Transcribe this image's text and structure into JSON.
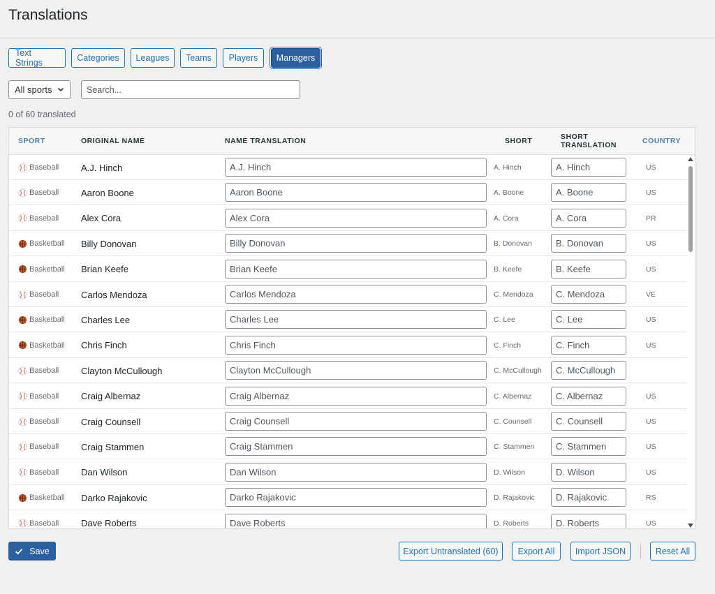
{
  "page": {
    "title": "Translations"
  },
  "tabs": [
    {
      "label": "Text Strings",
      "active": false
    },
    {
      "label": "Categories",
      "active": false
    },
    {
      "label": "Leagues",
      "active": false
    },
    {
      "label": "Teams",
      "active": false
    },
    {
      "label": "Players",
      "active": false
    },
    {
      "label": "Managers",
      "active": true
    }
  ],
  "filters": {
    "sport_select": {
      "selected": "All sports"
    },
    "search": {
      "placeholder": "Search...",
      "value": ""
    }
  },
  "progress": {
    "text": "0 of 60 translated"
  },
  "table": {
    "headers": {
      "sport": "SPORT",
      "original_name": "ORIGINAL NAME",
      "name_translation": "NAME TRANSLATION",
      "short": "SHORT",
      "short_translation_line1": "SHORT",
      "short_translation_line2": "TRANSLATION",
      "country": "COUNTRY"
    },
    "rows": [
      {
        "sport": "Baseball",
        "sport_icon": "baseball-icon",
        "original": "A.J. Hinch",
        "name_translation": "A.J. Hinch",
        "short": "A. Hinch",
        "short_translation": "A. Hinch",
        "country": "US"
      },
      {
        "sport": "Baseball",
        "sport_icon": "baseball-icon",
        "original": "Aaron Boone",
        "name_translation": "Aaron Boone",
        "short": "A. Boone",
        "short_translation": "A. Boone",
        "country": "US"
      },
      {
        "sport": "Baseball",
        "sport_icon": "baseball-icon",
        "original": "Alex Cora",
        "name_translation": "Alex Cora",
        "short": "A. Cora",
        "short_translation": "A. Cora",
        "country": "PR"
      },
      {
        "sport": "Basketball",
        "sport_icon": "basketball-icon",
        "original": "Billy Donovan",
        "name_translation": "Billy Donovan",
        "short": "B. Donovan",
        "short_translation": "B. Donovan",
        "country": "US"
      },
      {
        "sport": "Basketball",
        "sport_icon": "basketball-icon",
        "original": "Brian Keefe",
        "name_translation": "Brian Keefe",
        "short": "B. Keefe",
        "short_translation": "B. Keefe",
        "country": "US"
      },
      {
        "sport": "Baseball",
        "sport_icon": "baseball-icon",
        "original": "Carlos Mendoza",
        "name_translation": "Carlos Mendoza",
        "short": "C. Mendoza",
        "short_translation": "C. Mendoza",
        "country": "VE"
      },
      {
        "sport": "Basketball",
        "sport_icon": "basketball-icon",
        "original": "Charles Lee",
        "name_translation": "Charles Lee",
        "short": "C. Lee",
        "short_translation": "C. Lee",
        "country": "US"
      },
      {
        "sport": "Basketball",
        "sport_icon": "basketball-icon",
        "original": "Chris Finch",
        "name_translation": "Chris Finch",
        "short": "C. Finch",
        "short_translation": "C. Finch",
        "country": "US"
      },
      {
        "sport": "Baseball",
        "sport_icon": "baseball-icon",
        "original": "Clayton McCullough",
        "name_translation": "Clayton McCullough",
        "short": "C. McCullough",
        "short_translation": "C. McCullough",
        "country": ""
      },
      {
        "sport": "Baseball",
        "sport_icon": "baseball-icon",
        "original": "Craig Albernaz",
        "name_translation": "Craig Albernaz",
        "short": "C. Albernaz",
        "short_translation": "C. Albernaz",
        "country": "US"
      },
      {
        "sport": "Baseball",
        "sport_icon": "baseball-icon",
        "original": "Craig Counsell",
        "name_translation": "Craig Counsell",
        "short": "C. Counsell",
        "short_translation": "C. Counsell",
        "country": "US"
      },
      {
        "sport": "Baseball",
        "sport_icon": "baseball-icon",
        "original": "Craig Stammen",
        "name_translation": "Craig Stammen",
        "short": "C. Stammen",
        "short_translation": "C. Stammen",
        "country": "US"
      },
      {
        "sport": "Baseball",
        "sport_icon": "baseball-icon",
        "original": "Dan Wilson",
        "name_translation": "Dan Wilson",
        "short": "D. Wilson",
        "short_translation": "D. Wilson",
        "country": "US"
      },
      {
        "sport": "Basketball",
        "sport_icon": "basketball-icon",
        "original": "Darko Rajakovic",
        "name_translation": "Darko Rajakovic",
        "short": "D. Rajakovic",
        "short_translation": "D. Rajakovic",
        "country": "RS"
      },
      {
        "sport": "Baseball",
        "sport_icon": "baseball-icon",
        "original": "Dave Roberts",
        "name_translation": "Dave Roberts",
        "short": "D. Roberts",
        "short_translation": "D. Roberts",
        "country": "US"
      }
    ]
  },
  "footer": {
    "save_label": "Save",
    "export_untranslated_label": "Export Untranslated (60)",
    "export_all_label": "Export All",
    "import_json_label": "Import JSON",
    "reset_all_label": "Reset All"
  },
  "colors": {
    "accent": "#2271b1",
    "primary_button": "#2b5fa0",
    "background": "#f0f0f1",
    "basketball": "#c0562a",
    "baseball_stitch": "#d9534f"
  }
}
